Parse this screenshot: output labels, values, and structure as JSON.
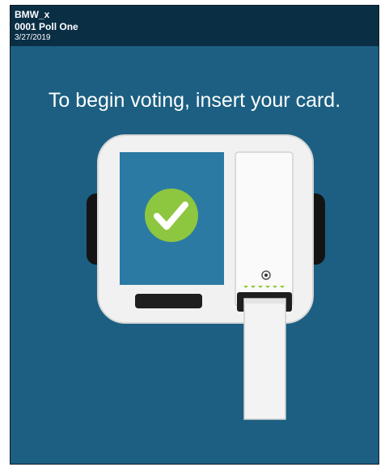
{
  "header": {
    "line1": "BMW_x",
    "line2": "0001 Poll One",
    "line3": "3/27/2019"
  },
  "prompt": {
    "title": "To begin voting, insert your card."
  },
  "colors": {
    "background": "#1c5f82",
    "header_bg": "#0a2e44",
    "check_circle": "#8dc63f",
    "screen": "#2b7aa3",
    "card_led": "#8dc63f"
  },
  "icons": {
    "status": "checkmark-icon"
  }
}
